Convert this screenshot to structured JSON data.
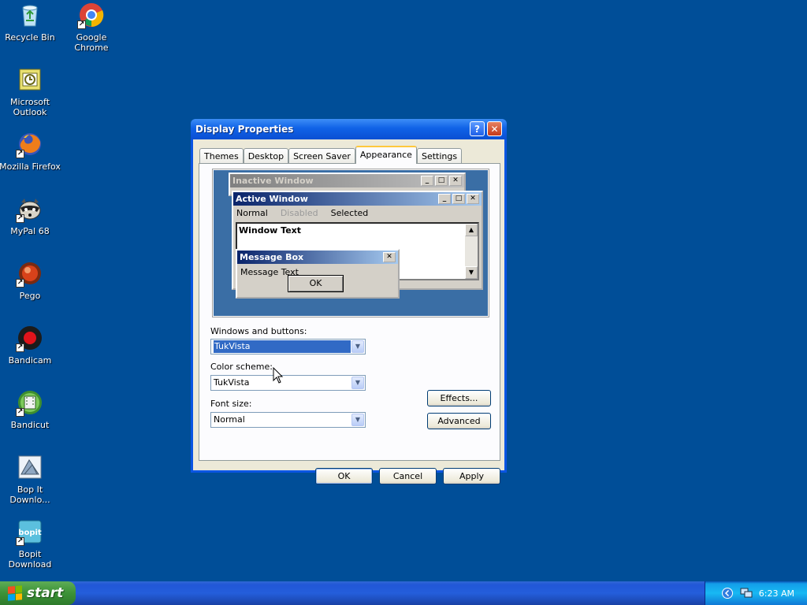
{
  "desktop_icons": [
    {
      "label": "Recycle Bin",
      "icon": "recycle-bin-icon"
    },
    {
      "label": "Google Chrome",
      "icon": "chrome-icon"
    },
    {
      "label": "Microsoft Outlook",
      "icon": "outlook-icon"
    },
    {
      "label": "Mozilla Firefox",
      "icon": "firefox-icon"
    },
    {
      "label": "MyPal 68",
      "icon": "mypal-icon"
    },
    {
      "label": "Pego",
      "icon": "pego-icon"
    },
    {
      "label": "Bandicam",
      "icon": "bandicam-icon"
    },
    {
      "label": "Bandicut",
      "icon": "bandicut-icon"
    },
    {
      "label": "Bop It Downlo...",
      "icon": "bop-it-icon"
    },
    {
      "label": "Bopit Download",
      "icon": "bopit-download-icon"
    }
  ],
  "window": {
    "title": "Display Properties",
    "tabs": [
      "Themes",
      "Desktop",
      "Screen Saver",
      "Appearance",
      "Settings"
    ],
    "active_tab": "Appearance",
    "preview": {
      "inactive_title": "Inactive Window",
      "active_title": "Active Window",
      "menu": {
        "normal": "Normal",
        "disabled": "Disabled",
        "selected": "Selected"
      },
      "window_text": "Window Text",
      "msgbox_title": "Message Box",
      "msgbox_text": "Message Text",
      "msgbox_ok": "OK"
    },
    "windows_buttons": {
      "label": "Windows and buttons:",
      "value": "TukVista"
    },
    "color_scheme": {
      "label": "Color scheme:",
      "value": "TukVista"
    },
    "font_size": {
      "label": "Font size:",
      "value": "Normal"
    },
    "effects_label": "Effects...",
    "advanced_label": "Advanced",
    "ok_label": "OK",
    "cancel_label": "Cancel",
    "apply_label": "Apply"
  },
  "taskbar": {
    "start_label": "start",
    "clock": "6:23 AM"
  },
  "colors": {
    "desktop": "#004e98",
    "xp_blue": "#0a55e3",
    "selection": "#316ac5"
  }
}
